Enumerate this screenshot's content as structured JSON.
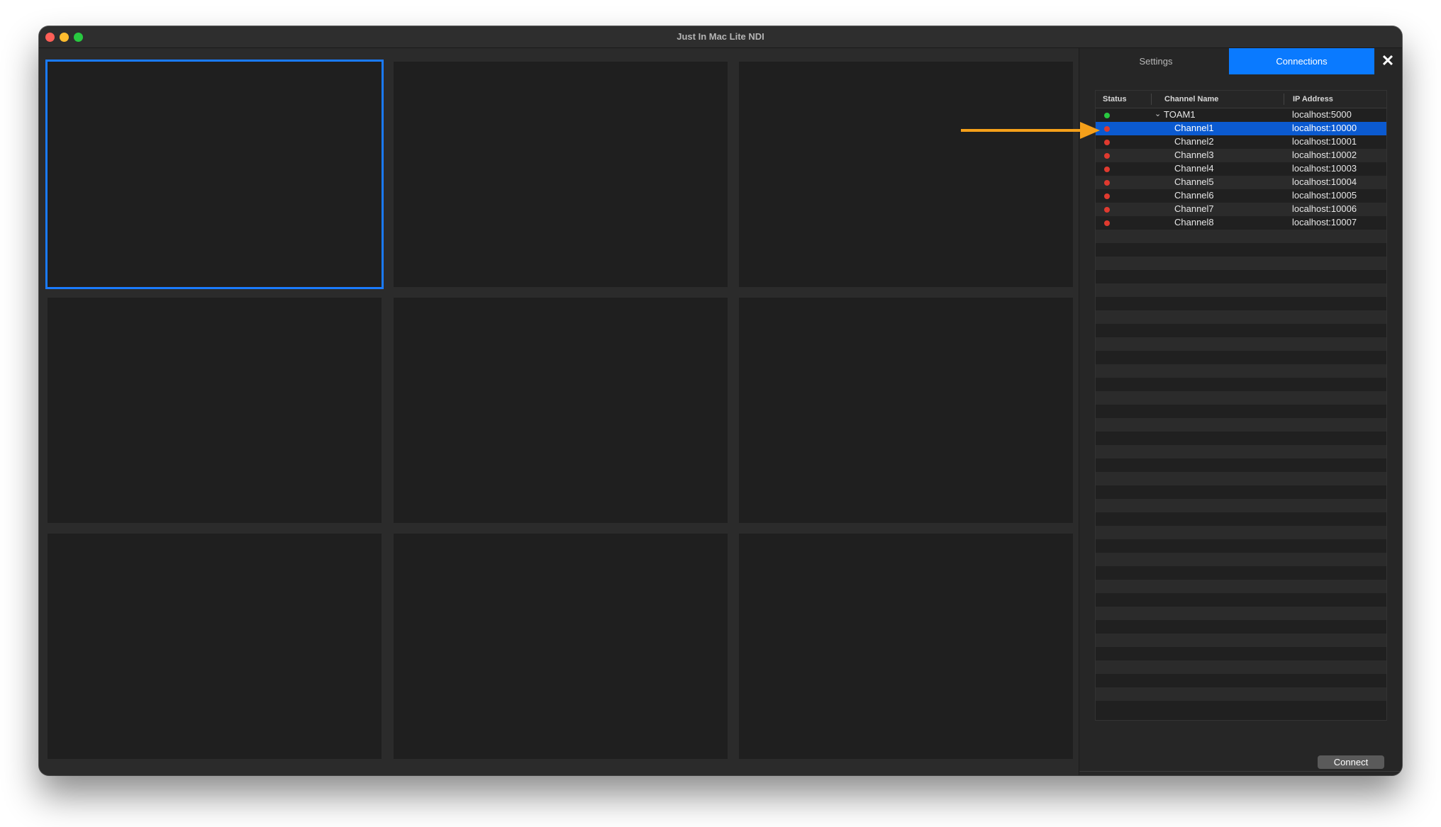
{
  "window": {
    "title": "Just In Mac Lite NDI"
  },
  "tabs": {
    "settings": "Settings",
    "connections": "Connections"
  },
  "table": {
    "columns": {
      "status": "Status",
      "channel_name": "Channel Name",
      "ip_address": "IP Address"
    },
    "rows": [
      {
        "status": "connected",
        "name": "TOAM1",
        "ip": "localhost:5000",
        "group": true
      },
      {
        "status": "disconnected",
        "name": "Channel1",
        "ip": "localhost:10000",
        "selected": true
      },
      {
        "status": "disconnected",
        "name": "Channel2",
        "ip": "localhost:10001"
      },
      {
        "status": "disconnected",
        "name": "Channel3",
        "ip": "localhost:10002"
      },
      {
        "status": "disconnected",
        "name": "Channel4",
        "ip": "localhost:10003"
      },
      {
        "status": "disconnected",
        "name": "Channel5",
        "ip": "localhost:10004"
      },
      {
        "status": "disconnected",
        "name": "Channel6",
        "ip": "localhost:10005"
      },
      {
        "status": "disconnected",
        "name": "Channel7",
        "ip": "localhost:10006"
      },
      {
        "status": "disconnected",
        "name": "Channel8",
        "ip": "localhost:10007"
      }
    ]
  },
  "buttons": {
    "connect": "Connect"
  },
  "colors": {
    "accent": "#0a7aff",
    "status_connected": "#28c840",
    "status_disconnected": "#e03a2f",
    "annotation_arrow": "#f5a01a"
  }
}
